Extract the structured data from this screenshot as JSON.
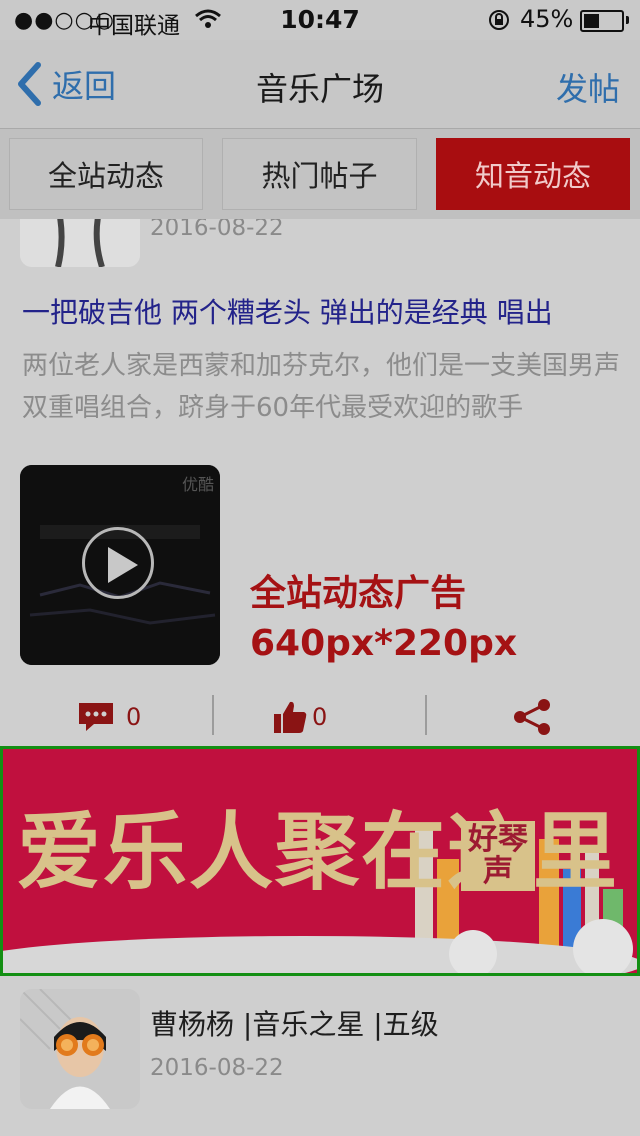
{
  "status_bar": {
    "signal": "●●○○○",
    "carrier": "中国联通",
    "time": "10:47",
    "battery_percent": "45%",
    "battery_level": 0.45
  },
  "nav": {
    "back_label": "返回",
    "title": "音乐广场",
    "post_label": "发帖"
  },
  "tabs": [
    {
      "label": "全站动态",
      "selected": false
    },
    {
      "label": "热门帖子",
      "selected": false
    },
    {
      "label": "知音动态",
      "selected": true
    }
  ],
  "posts": [
    {
      "date": "2016-08-22",
      "title": "一把破吉他 两个糟老头 弹出的是经典 唱出",
      "body": "两位老人家是西蒙和加芬克尔，他们是一支美国男声双重唱组合，跻身于60年代最受欢迎的歌手",
      "video_watermark": "优酷",
      "comments": "0",
      "likes": "0"
    },
    {
      "author": "曹杨杨 |音乐之星 |五级",
      "date": "2016-08-22"
    }
  ],
  "ad_note": {
    "line1": "全站动态广告",
    "line2": "640px*220px"
  },
  "banner": {
    "text": "爱乐人聚在这里",
    "badge": "好琴声"
  },
  "colors": {
    "accent_blue": "#2f6eac",
    "selected_tab": "#a80d10",
    "ad_frame": "#138f13",
    "banner_bg": "#c0103e"
  }
}
